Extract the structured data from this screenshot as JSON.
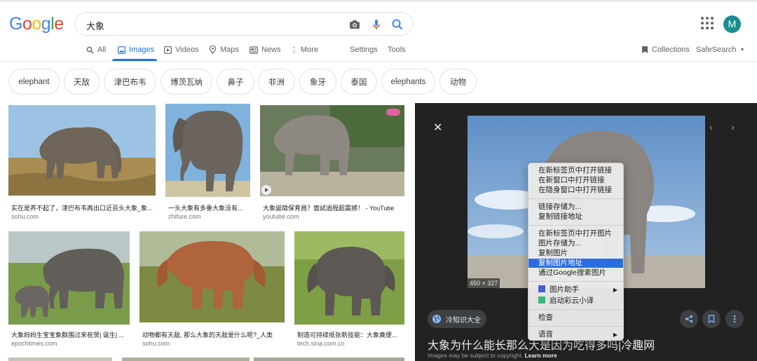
{
  "header": {
    "logo": "Google",
    "search_query": "大象",
    "avatar_letter": "M",
    "colors": {
      "blue": "#4285f4",
      "red": "#ea4335",
      "yellow": "#fbbc05",
      "green": "#34a853",
      "avatar": "#1a8e8e"
    }
  },
  "tabs": {
    "all": "All",
    "images": "Images",
    "videos": "Videos",
    "maps": "Maps",
    "news": "News",
    "more": "More",
    "settings": "Settings",
    "tools": "Tools",
    "collections": "Collections",
    "safesearch": "SafeSearch"
  },
  "chips": [
    "elephant",
    "天敌",
    "津巴布韦",
    "博茨瓦纳",
    "鼻子",
    "非洲",
    "象牙",
    "泰国",
    "elephants",
    "动物"
  ],
  "results": [
    {
      "caption": "实在是养不起了，津巴布韦再出口近百头大象_象...",
      "source": "sohu.com"
    },
    {
      "caption": "一头大象有多重大象没有...",
      "source": "zhifure.com"
    },
    {
      "caption": "大象誕徵保育員？面試過程超震撼！ - YouTube",
      "source": "youtube.com"
    },
    {
      "caption": "大象妈妈生宝宝象群围过来祝贺| 诞生| ...",
      "source": "epochtimes.com"
    },
    {
      "caption": "动物都有天敌, 那么大象的天敌是什么呢?_人类",
      "source": "sohu.com"
    },
    {
      "caption": "制造可持续纸张新技能：大象粪便...",
      "source": "tech.sina.com.cn"
    }
  ],
  "panel": {
    "dimensions": "450 × 327",
    "site_name": "冷知识大全",
    "title": "大象为什么能长那么大是因为吃得多吗|冷趣网",
    "note": "Images may be subject to copyright.",
    "learn_more": "Learn more"
  },
  "context_menu": {
    "items": [
      "在新标签页中打开链接",
      "在新窗口中打开链接",
      "在隐身窗口中打开链接",
      "链接存储为...",
      "复制链接地址",
      "在新标签页中打开图片",
      "图片存储为...",
      "复制图片",
      "复制图片地址",
      "通过Google搜索图片",
      "图片助手",
      "启动彩云小译",
      "检查",
      "语音"
    ],
    "selected_color": "#2b6dde"
  }
}
